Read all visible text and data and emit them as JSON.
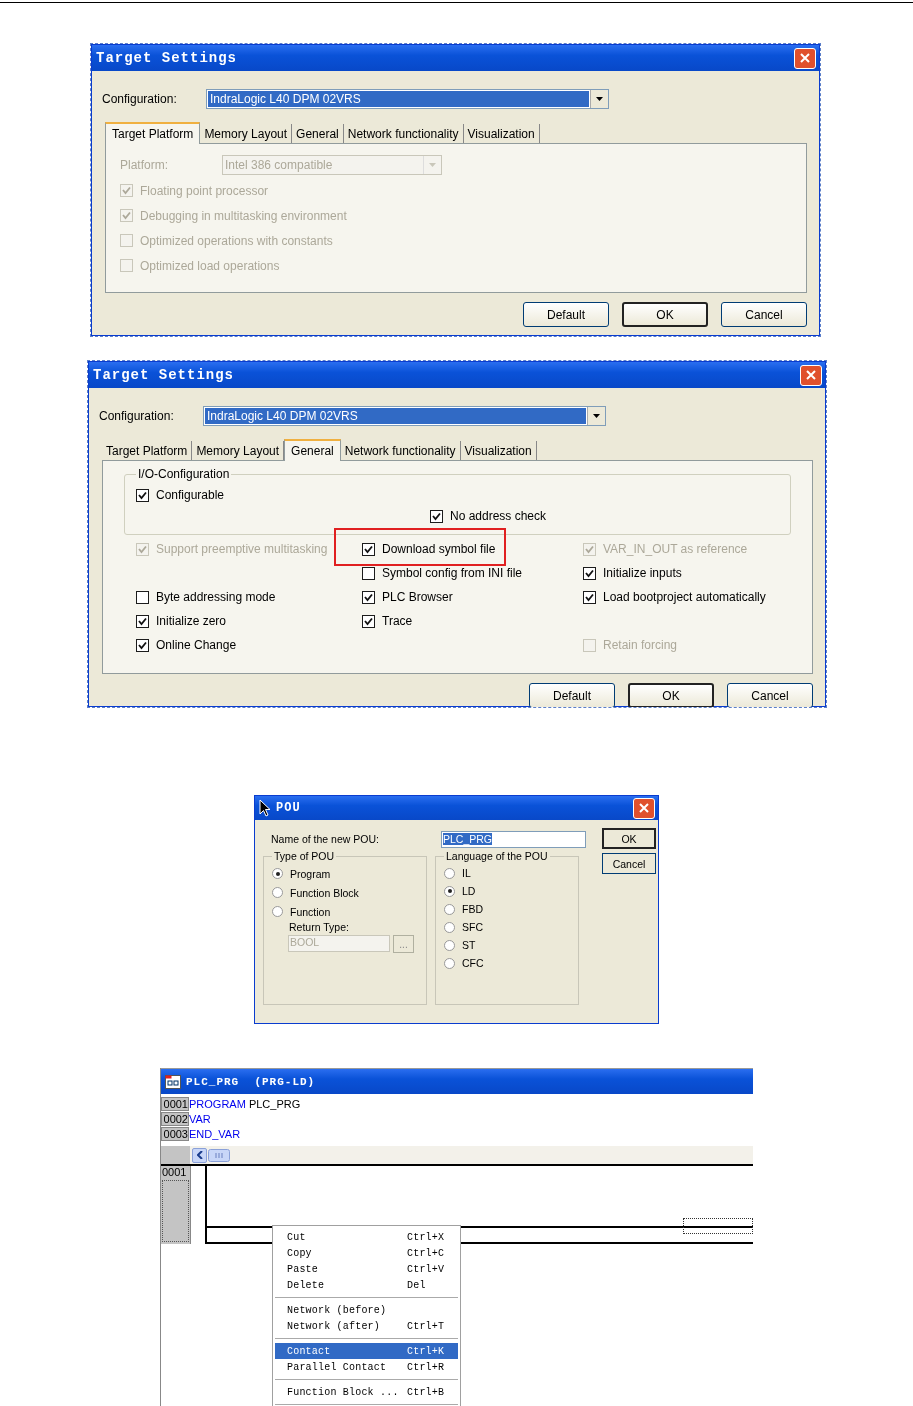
{
  "figures": [
    {
      "kind": "target_settings",
      "title": "Target Settings",
      "config_label": "Configuration:",
      "config_value": "IndraLogic L40 DPM 02VRS",
      "tabs": [
        {
          "label": "Target Platform",
          "selected": true
        },
        {
          "label": "Memory Layout",
          "selected": false
        },
        {
          "label": "General",
          "selected": false
        },
        {
          "label": "Network functionality",
          "selected": false
        },
        {
          "label": "Visualization",
          "selected": false
        }
      ],
      "controls": [
        {
          "kind": "combo",
          "label": "Platform:",
          "value": "Intel 386 compatible",
          "disabled": true
        },
        {
          "kind": "checkbox",
          "label": "Floating point processor",
          "checked": true,
          "disabled": true
        },
        {
          "kind": "checkbox",
          "label": "Debugging in multitasking environment",
          "checked": true,
          "disabled": true
        },
        {
          "kind": "checkbox",
          "label": "Optimized operations with constants",
          "checked": false,
          "disabled": true
        },
        {
          "kind": "checkbox",
          "label": "Optimized load operations",
          "checked": false,
          "disabled": true
        }
      ],
      "buttons": [
        {
          "label": "Default",
          "default": false
        },
        {
          "label": "OK",
          "default": true
        },
        {
          "label": "Cancel",
          "default": false
        }
      ]
    },
    {
      "kind": "target_settings",
      "title": "Target Settings",
      "config_label": "Configuration:",
      "config_value": "IndraLogic L40 DPM 02VRS",
      "tabs": [
        {
          "label": "Target Platform",
          "selected": false
        },
        {
          "label": "Memory Layout",
          "selected": false
        },
        {
          "label": "General",
          "selected": true
        },
        {
          "label": "Network functionality",
          "selected": false
        },
        {
          "label": "Visualization",
          "selected": false
        }
      ],
      "group": {
        "title": "I/O-Configuration",
        "options": [
          {
            "label": "Configurable",
            "checked": true,
            "disabled": false
          },
          {
            "label": "No address check",
            "checked": true,
            "disabled": false
          }
        ]
      },
      "columns": [
        [
          {
            "kind": "checkbox",
            "label": "Support preemptive multitasking",
            "checked": true,
            "disabled": true
          },
          {
            "kind": "blank"
          },
          {
            "kind": "checkbox",
            "label": "Byte addressing mode",
            "checked": false,
            "disabled": false
          },
          {
            "kind": "checkbox",
            "label": "Initialize zero",
            "checked": true,
            "disabled": false
          },
          {
            "kind": "checkbox",
            "label": "Online Change",
            "checked": true,
            "disabled": false
          }
        ],
        [
          {
            "kind": "checkbox",
            "label": "Download symbol file",
            "checked": true,
            "disabled": false,
            "highlighted": true
          },
          {
            "kind": "checkbox",
            "label": "Symbol config from INI file",
            "checked": false,
            "disabled": false
          },
          {
            "kind": "checkbox",
            "label": "PLC Browser",
            "checked": true,
            "disabled": false
          },
          {
            "kind": "checkbox",
            "label": "Trace",
            "checked": true,
            "disabled": false
          },
          {
            "kind": "blank"
          }
        ],
        [
          {
            "kind": "checkbox",
            "label": "VAR_IN_OUT as reference",
            "checked": true,
            "disabled": true
          },
          {
            "kind": "checkbox",
            "label": "Initialize inputs",
            "checked": true,
            "disabled": false
          },
          {
            "kind": "checkbox",
            "label": "Load bootproject automatically",
            "checked": true,
            "disabled": false
          },
          {
            "kind": "blank"
          },
          {
            "kind": "checkbox",
            "label": "Retain forcing",
            "checked": false,
            "disabled": true
          }
        ]
      ],
      "buttons": [
        {
          "label": "Default",
          "default": false
        },
        {
          "label": "OK",
          "default": true
        },
        {
          "label": "Cancel",
          "default": false
        }
      ]
    },
    {
      "kind": "new_pou",
      "title": "POU",
      "name_label": "Name of the new POU:",
      "name_value": "PLC_PRG",
      "name_selected": true,
      "type_group": {
        "title": "Type of POU",
        "options": [
          {
            "label": "Program",
            "selected": true
          },
          {
            "label": "Function Block",
            "selected": false
          },
          {
            "label": "Function",
            "selected": false
          }
        ],
        "return_label": "Return Type:",
        "return_value": "BOOL",
        "browse": "..."
      },
      "language_group": {
        "title": "Language of the POU",
        "options": [
          {
            "label": "IL",
            "selected": false
          },
          {
            "label": "LD",
            "selected": true
          },
          {
            "label": "FBD",
            "selected": false
          },
          {
            "label": "SFC",
            "selected": false
          },
          {
            "label": "ST",
            "selected": false
          },
          {
            "label": "CFC",
            "selected": false
          }
        ]
      },
      "buttons": [
        {
          "label": "OK",
          "default": true
        },
        {
          "label": "Cancel",
          "default": false
        }
      ]
    },
    {
      "kind": "editor",
      "title": "PLC_PRG  (PRG-LD)",
      "lines": [
        {
          "number": "0001",
          "tokens": [
            {
              "text": "PROGRAM",
              "kind": "keyword"
            },
            {
              "text": " PLC_PRG",
              "kind": "plain"
            }
          ]
        },
        {
          "number": "0002",
          "tokens": [
            {
              "text": "VAR",
              "kind": "keyword"
            }
          ]
        },
        {
          "number": "0003",
          "tokens": [
            {
              "text": "END_VAR",
              "kind": "keyword"
            }
          ]
        }
      ],
      "network": "0001",
      "menu": [
        [
          {
            "label": "Cut",
            "shortcut": "Ctrl+X",
            "selected": false
          },
          {
            "label": "Copy",
            "shortcut": "Ctrl+C",
            "selected": false
          },
          {
            "label": "Paste",
            "shortcut": "Ctrl+V",
            "selected": false
          },
          {
            "label": "Delete",
            "shortcut": "Del",
            "selected": false
          }
        ],
        [
          {
            "label": "Network (before)",
            "selected": false
          },
          {
            "label": "Network (after)",
            "shortcut": "Ctrl+T",
            "selected": false
          }
        ],
        [
          {
            "label": "Contact",
            "shortcut": "Ctrl+K",
            "selected": true
          },
          {
            "label": "Parallel Contact",
            "shortcut": "Ctrl+R",
            "selected": false
          }
        ],
        [
          {
            "label": "Function Block ...",
            "shortcut": "Ctrl+B",
            "selected": false
          }
        ]
      ]
    }
  ]
}
